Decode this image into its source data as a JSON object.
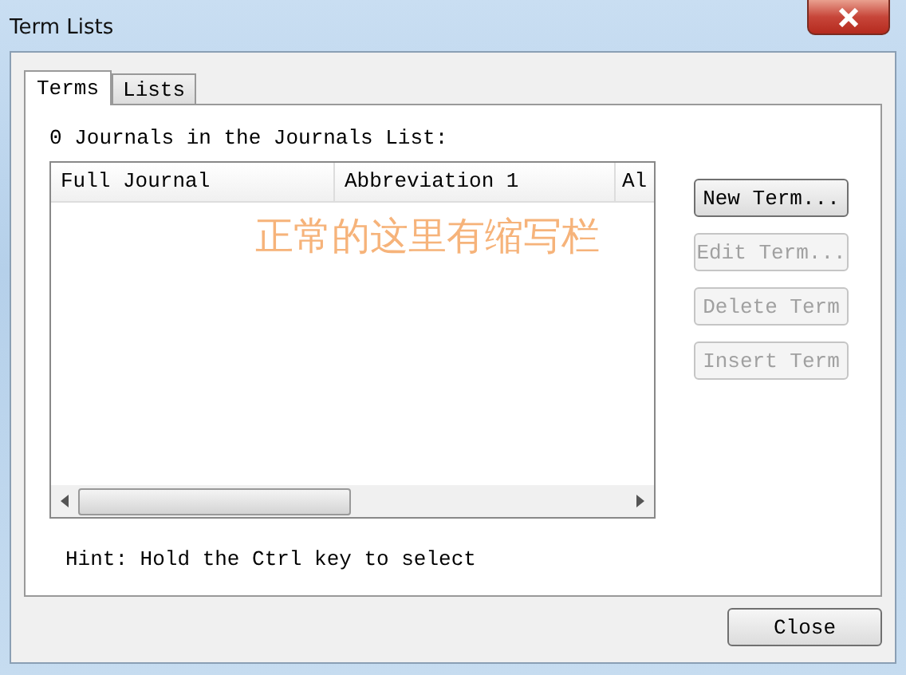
{
  "window": {
    "title": "Term Lists"
  },
  "tabs": [
    {
      "label": "Terms",
      "selected": true
    },
    {
      "label": "Lists",
      "selected": false
    }
  ],
  "count_label": "0 Journals in the Journals List:",
  "table": {
    "columns": [
      {
        "label": "Full Journal"
      },
      {
        "label": "Abbreviation 1"
      },
      {
        "label": "Al"
      }
    ]
  },
  "annotation": "正常的这里有缩写栏",
  "buttons": [
    {
      "label": "New Term...",
      "disabled": false
    },
    {
      "label": "Edit Term...",
      "disabled": true
    },
    {
      "label": "Delete Term",
      "disabled": true
    },
    {
      "label": "Insert Term",
      "disabled": true
    }
  ],
  "hint": "Hint: Hold the Ctrl key to select",
  "footer_buttons": [
    {
      "label": "Close",
      "disabled": false
    }
  ]
}
